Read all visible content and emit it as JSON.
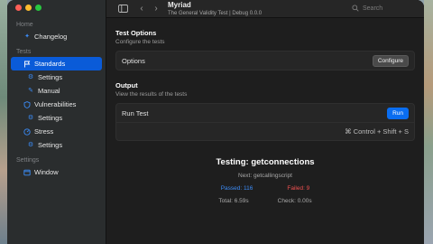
{
  "window": {
    "app_title": "Myriad",
    "subtitle": "The General Validity Test | Debug 0.0.0",
    "search_placeholder": "Search"
  },
  "sidebar": {
    "sections": [
      {
        "label": "Home"
      },
      {
        "label": "Tests"
      },
      {
        "label": "Settings"
      }
    ],
    "items": [
      {
        "label": "Changelog",
        "icon": "sparkle-icon"
      },
      {
        "label": "Standards",
        "icon": "flag-icon",
        "active": true
      },
      {
        "label": "Settings",
        "icon": "gear-icon"
      },
      {
        "label": "Manual",
        "icon": "pencil-icon"
      },
      {
        "label": "Vulnerabilities",
        "icon": "shield-icon"
      },
      {
        "label": "Settings",
        "icon": "gear-icon"
      },
      {
        "label": "Stress",
        "icon": "gauge-icon"
      },
      {
        "label": "Settings",
        "icon": "gear-icon"
      },
      {
        "label": "Window",
        "icon": "window-icon"
      }
    ]
  },
  "main": {
    "options": {
      "title": "Test Options",
      "subtitle": "Configure the tests",
      "row_label": "Options",
      "button": "Configure"
    },
    "output": {
      "title": "Output",
      "subtitle": "View the results of the tests",
      "row_label": "Run Test",
      "button": "Run",
      "shortcut": "⌘ Control + Shift + S"
    },
    "status": {
      "title": "Testing: getconnections",
      "next": "Next: getcallingscript",
      "passed": "Passed: 116",
      "failed": "Failed: 9",
      "total": "Total: 6.59s",
      "check": "Check: 0.00s"
    }
  },
  "colors": {
    "accent": "#0a6df0",
    "passed": "#3c8bf6",
    "failed": "#f05050"
  }
}
